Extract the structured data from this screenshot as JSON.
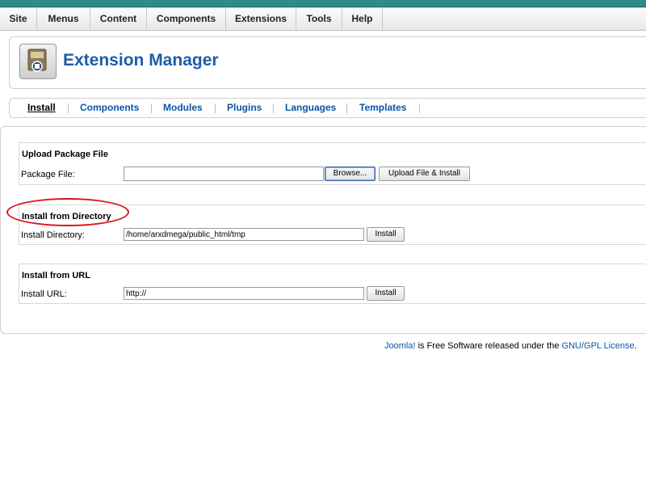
{
  "menubar": {
    "items": [
      "Site",
      "Menus",
      "Content",
      "Components",
      "Extensions",
      "Tools",
      "Help"
    ]
  },
  "header": {
    "title": "Extension Manager",
    "icon": "extension-manager-icon"
  },
  "tabs": {
    "items": [
      "Install",
      "Components",
      "Modules",
      "Plugins",
      "Languages",
      "Templates"
    ],
    "active": "Install"
  },
  "upload": {
    "title": "Upload Package File",
    "label": "Package File:",
    "value": "",
    "browse_label": "Browse...",
    "submit_label": "Upload File & Install"
  },
  "directory": {
    "title": "Install from Directory",
    "label": "Install Directory:",
    "value": "/home/arxdmega/public_html/tmp",
    "button_label": "Install"
  },
  "url": {
    "title": "Install from URL",
    "label": "Install URL:",
    "value": "http://",
    "button_label": "Install"
  },
  "footer": {
    "link1": "Joomla!",
    "middle": " is Free Software released under the ",
    "link2": "GNU/GPL License",
    "end": "."
  },
  "colors": {
    "accent": "#1b5ea6",
    "link": "#0b55a8",
    "topbar": "#2e8b88",
    "annotation": "#dd1111"
  }
}
